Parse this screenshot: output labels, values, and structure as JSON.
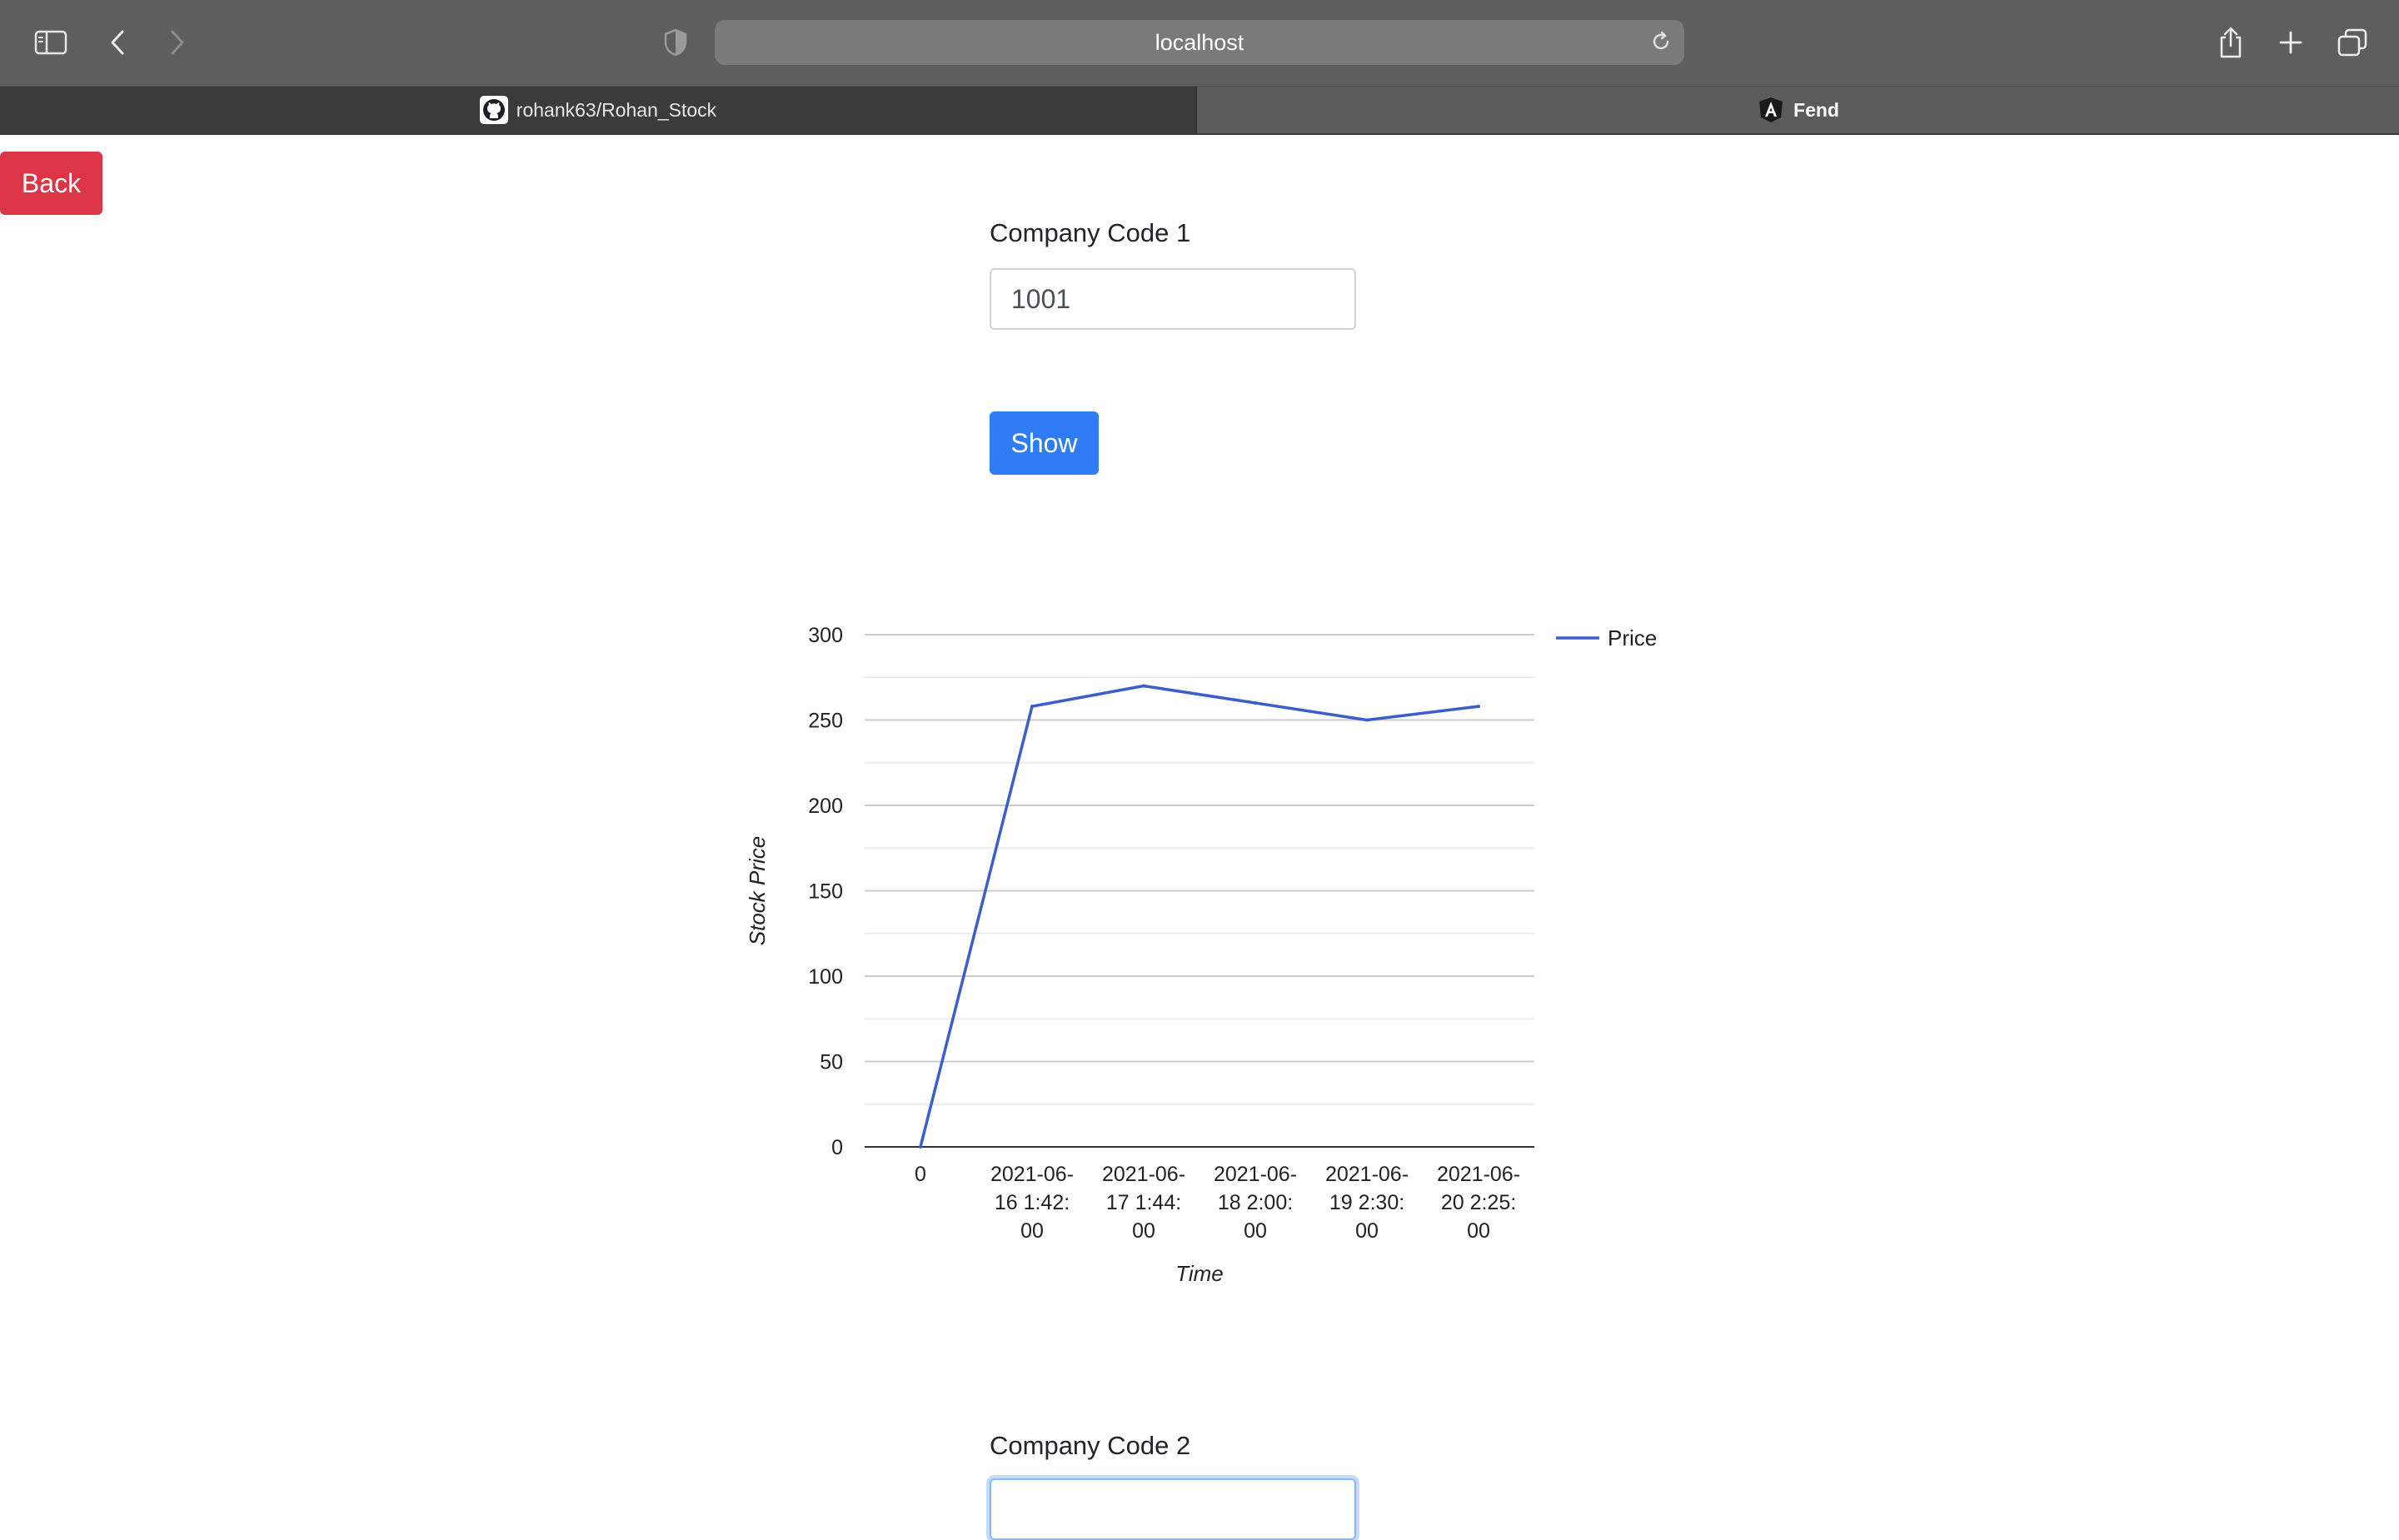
{
  "browser": {
    "url": "localhost",
    "tabs": [
      {
        "label": "rohank63/Rohan_Stock",
        "icon": "github-icon",
        "active": false
      },
      {
        "label": "Fend",
        "icon": "angular-icon",
        "active": true
      }
    ]
  },
  "page": {
    "back_label": "Back",
    "company1": {
      "label": "Company Code 1",
      "value": "1001"
    },
    "show_label": "Show",
    "company2": {
      "label": "Company Code 2",
      "value": ""
    }
  },
  "colors": {
    "danger": "#dc3545",
    "primary": "#2f7cf6",
    "line": "#3b5fc9",
    "chrome": "#5e5e5e"
  },
  "chart_data": {
    "type": "line",
    "categories": [
      "0",
      "2021-06-16 1:42:00",
      "2021-06-17 1:44:00",
      "2021-06-18 2:00:00",
      "2021-06-19 2:30:00",
      "2021-06-20 2:25:00"
    ],
    "category_label_lines": [
      [
        "0"
      ],
      [
        "2021-06-",
        "16 1:42:",
        "00"
      ],
      [
        "2021-06-",
        "17 1:44:",
        "00"
      ],
      [
        "2021-06-",
        "18 2:00:",
        "00"
      ],
      [
        "2021-06-",
        "19 2:30:",
        "00"
      ],
      [
        "2021-06-",
        "20 2:25:",
        "00"
      ]
    ],
    "series": [
      {
        "name": "Price",
        "values": [
          0,
          258,
          270,
          260,
          250,
          258
        ]
      }
    ],
    "xlabel": "Time",
    "ylabel": "Stock Price",
    "ylim": [
      0,
      300
    ],
    "yticks": [
      0,
      50,
      100,
      150,
      200,
      250,
      300
    ],
    "grid": true,
    "minor_grid": true,
    "legend": "top-right"
  }
}
